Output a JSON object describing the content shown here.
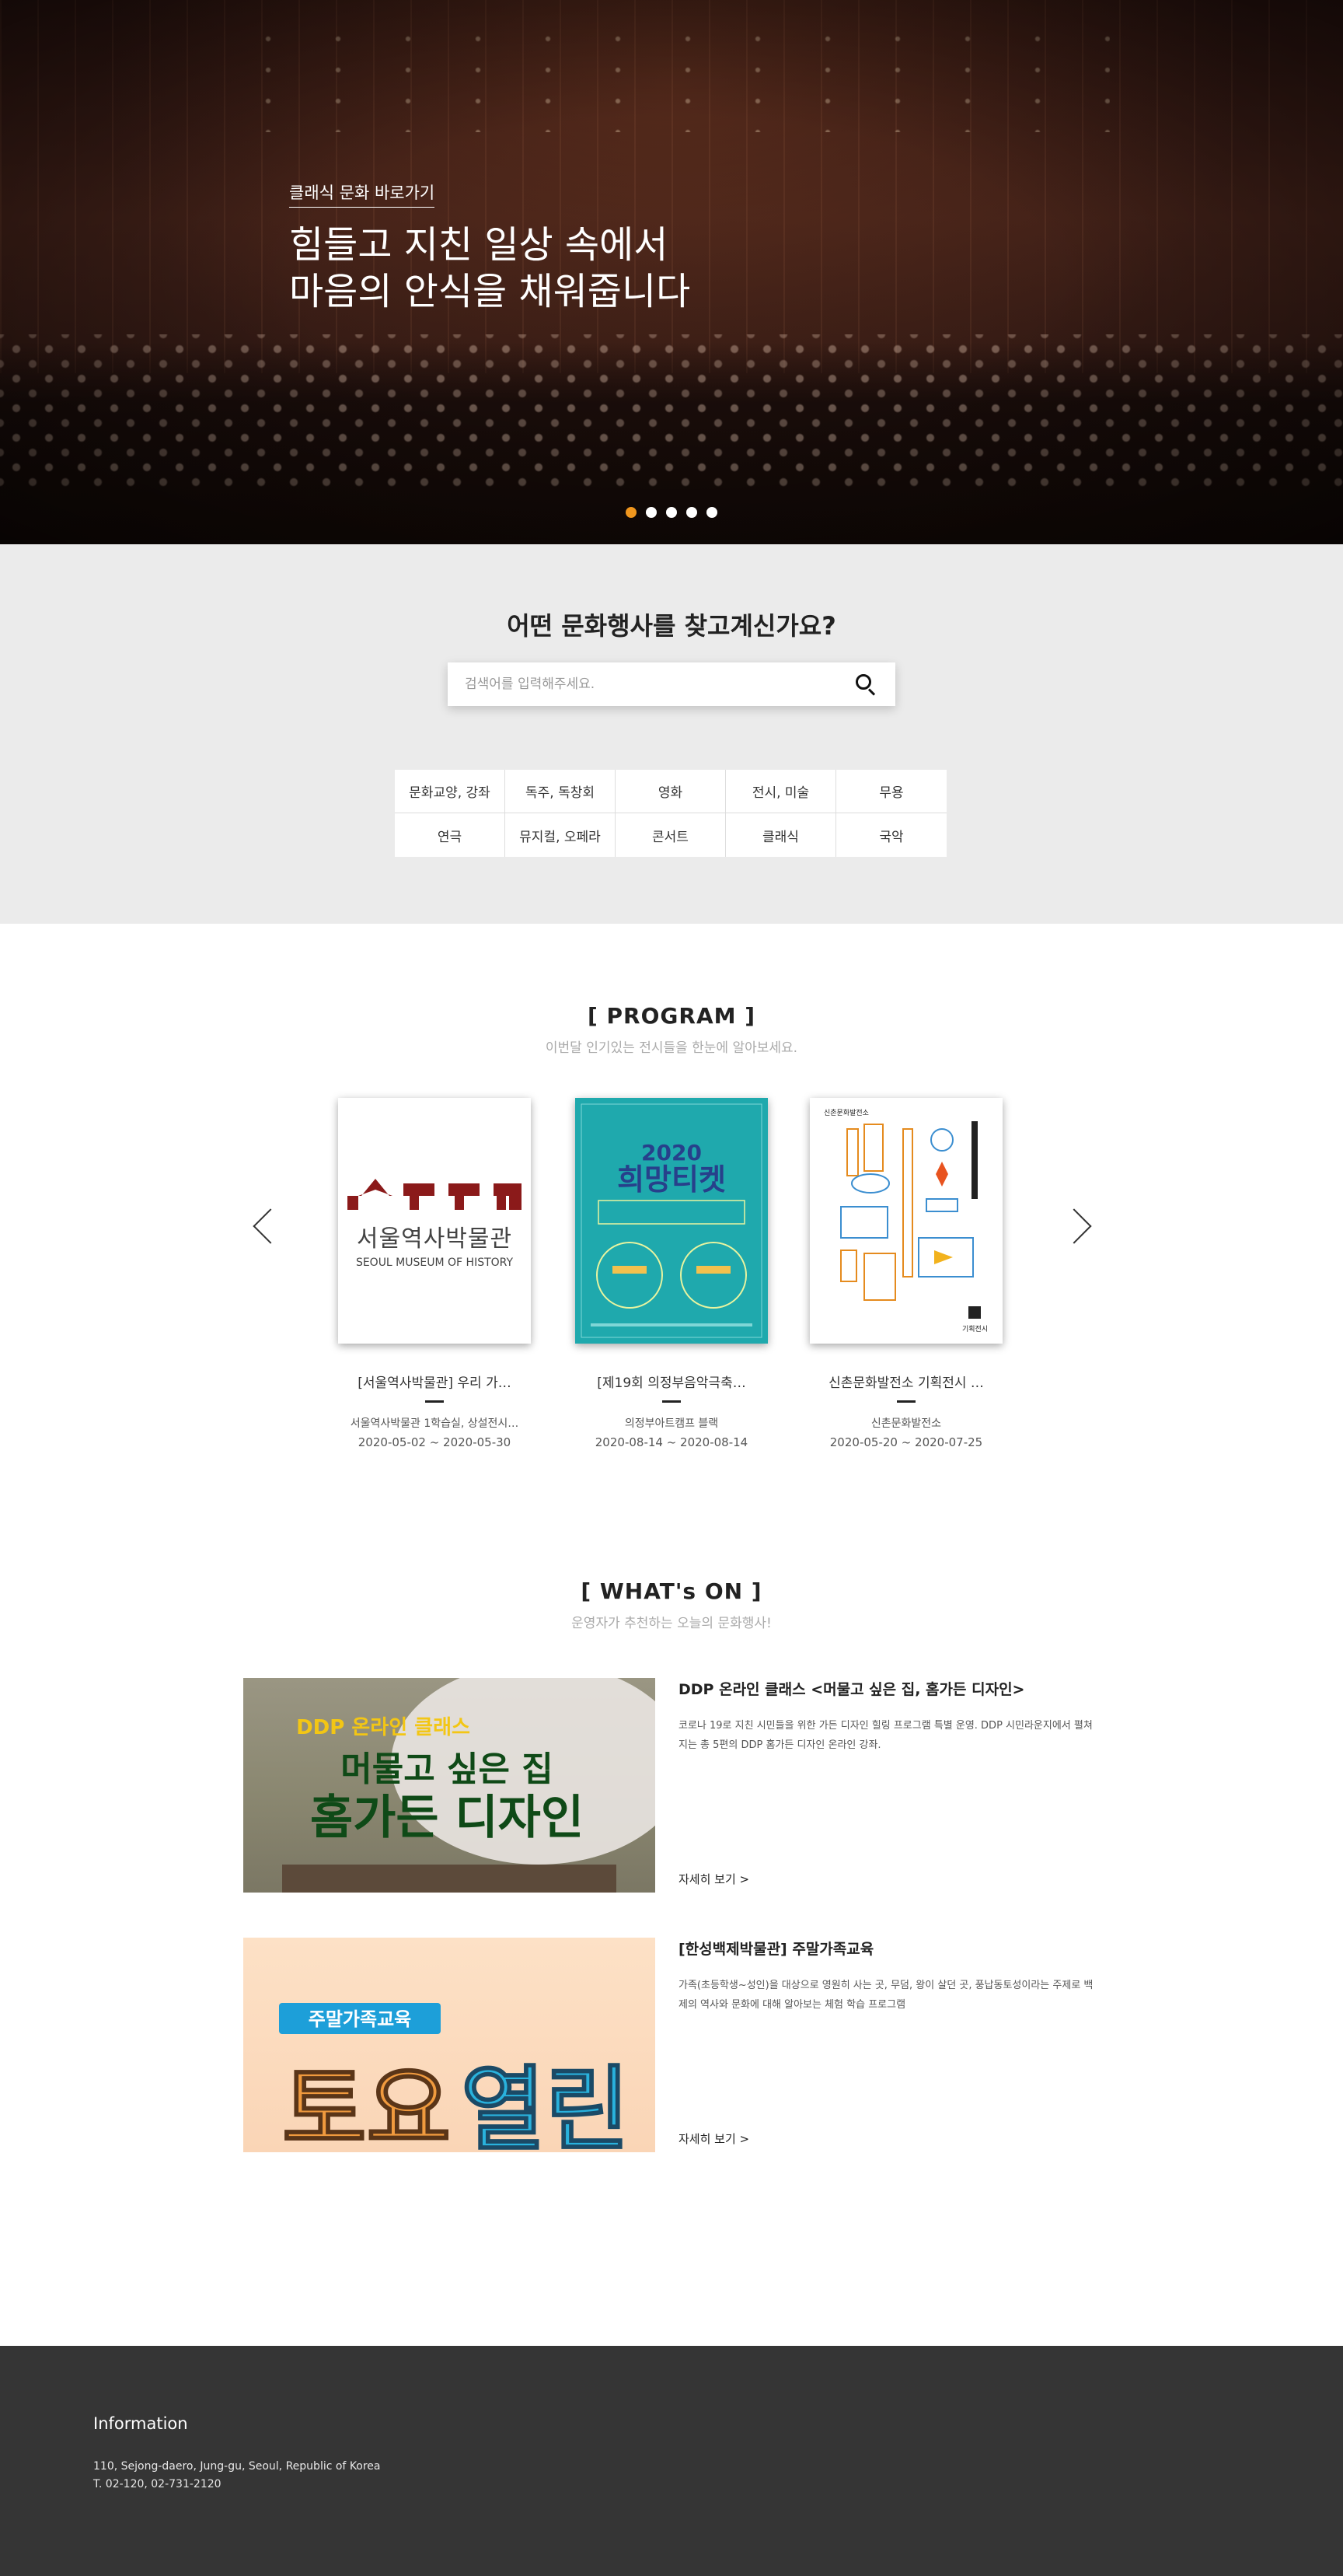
{
  "hero": {
    "kicker": "클래식 문화 바로가기",
    "title_line1": "힘들고 지친 일상 속에서",
    "title_line2": "마음의 안식을 채워줍니다",
    "slides_total": 5,
    "active_slide": 1
  },
  "search": {
    "heading": "어떤 문화행사를 찾고계신가요?",
    "placeholder": "검색어를 입력해주세요.",
    "categories": [
      "문화교양, 강좌",
      "독주, 독창회",
      "영화",
      "전시, 미술",
      "무용",
      "연극",
      "뮤지컬, 오페라",
      "콘서트",
      "클래식",
      "국악"
    ]
  },
  "program": {
    "title": "[ PROGRAM ]",
    "subtitle": "이번달 인기있는 전시들을 한눈에 알아보세요.",
    "cards": [
      {
        "title": "[서울역사박물관] 우리 가…",
        "place": "서울역사박물관 1학습실, 상설전시…",
        "date": "2020-05-02 ~ 2020-05-30",
        "poster_text": "서울역사박물관",
        "poster_sub": "SEOUL MUSEUM OF HISTORY"
      },
      {
        "title": "[제19회 의정부음악극축…",
        "place": "의정부아트캠프 블랙",
        "date": "2020-08-14 ~ 2020-08-14",
        "poster_year": "2020",
        "poster_text": "희망티켓"
      },
      {
        "title": "신촌문화발전소 기획전시 …",
        "place": "신촌문화발전소",
        "date": "2020-05-20 ~ 2020-07-25",
        "poster_header": "신촌문화발전소",
        "poster_footer": "기획전시"
      }
    ]
  },
  "whatson": {
    "title": "[ WHAT's ON ]",
    "subtitle": "운영자가 추천하는 오늘의 문화행사!",
    "events": [
      {
        "title": "DDP 온라인 클래스 <머물고 싶은 집, 홈가든 디자인>",
        "desc": "코로나 19로 지친 시민들을 위한 가든 디자인 힐링 프로그램 특별 운영. DDP 시민라운지에서 펼쳐지는 총 5편의 DDP 홈가든 디자인 온라인 강좌.",
        "more": "자세히 보기 >",
        "img_line1": "DDP 온라인 클래스",
        "img_line2": "머물고 싶은 집",
        "img_line3": "홈가든 디자인"
      },
      {
        "title": "[한성백제박물관] 주말가족교육",
        "desc": "가족(초등학생~성인)을 대상으로 영원히 사는 곳, 무덤, 왕이 살던 곳, 풍납동토성이라는 주제로 백제의 역사와 문화에 대해 알아보는 체험 학습 프로그램",
        "more": "자세히 보기 >",
        "img_badge": "주말가족교육",
        "img_title_a": "토요",
        "img_title_b": "열린"
      }
    ]
  },
  "footer": {
    "title": "Information",
    "address": "110, Sejong-daero, Jung-gu, Seoul, Republic of Korea",
    "phone": "T. 02-120, 02-731-2120"
  },
  "colors": {
    "accent": "#f0961e",
    "search_bg": "#ebebeb",
    "footer_bg": "#353535",
    "poster_teal": "#1fa9ad",
    "museum_red": "#8b1a1a"
  }
}
